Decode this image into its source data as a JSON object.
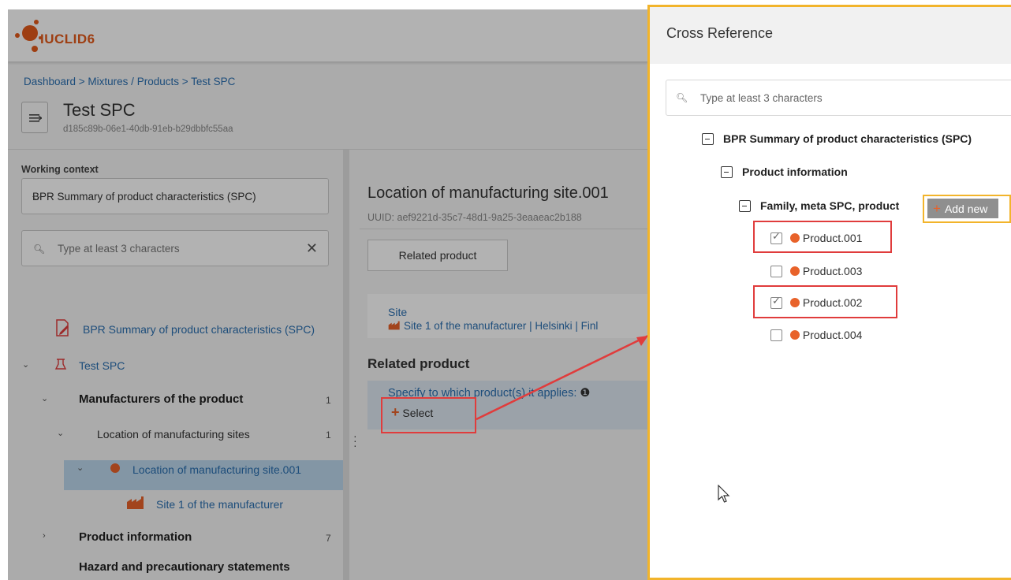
{
  "app": {
    "logo_text": "IUCLID",
    "logo_version": "6",
    "breadcrumb": "Dashboard > Mixtures / Products > Test SPC",
    "document_title": "Test SPC",
    "document_uuid": "d185c89b-06e1-40db-91eb-b29dbbfc55aa"
  },
  "sidebar": {
    "working_context_label": "Working context",
    "working_context_value": "BPR Summary of product characteristics (SPC)",
    "search_placeholder": "Type at least 3 characters",
    "tree": {
      "root": "BPR Summary of product characteristics (SPC)",
      "doc": "Test SPC",
      "manufacturers": "Manufacturers of the product",
      "manufacturers_count": "1",
      "locations": "Location of manufacturing sites",
      "locations_count": "1",
      "location_001": "Location of manufacturing site.001",
      "site": "Site 1 of the manufacturer",
      "product_information": "Product information",
      "product_information_count": "7",
      "hazard": "Hazard and precautionary statements"
    }
  },
  "content": {
    "title": "Location of manufacturing site.001",
    "uuid": "UUID: aef9221d-35c7-48d1-9a25-3eaaeac2b188",
    "tab_related_product": "Related product",
    "site_label": "Site",
    "site_value": "Site 1 of the manufacturer | Helsinki | Finl",
    "related_product_heading": "Related product",
    "specify_label": "Specify to which product(s) it applies:",
    "select_label": "Select"
  },
  "dialog": {
    "title": "Cross Reference",
    "search_placeholder": "Type at least 3 characters",
    "tree_root": "BPR Summary of product characteristics (SPC)",
    "tree_section": "Product information",
    "tree_subsection": "Family, meta SPC, product",
    "add_new_label": "Add new",
    "products": [
      {
        "label": "Product.001",
        "checked": true
      },
      {
        "label": "Product.003",
        "checked": false
      },
      {
        "label": "Product.002",
        "checked": true
      },
      {
        "label": "Product.004",
        "checked": false
      }
    ]
  },
  "colors": {
    "accent_orange": "#e8622a",
    "highlight_yellow": "#f2b42b",
    "annotation_red": "#e03c3c",
    "link_blue": "#2a6fb0"
  }
}
